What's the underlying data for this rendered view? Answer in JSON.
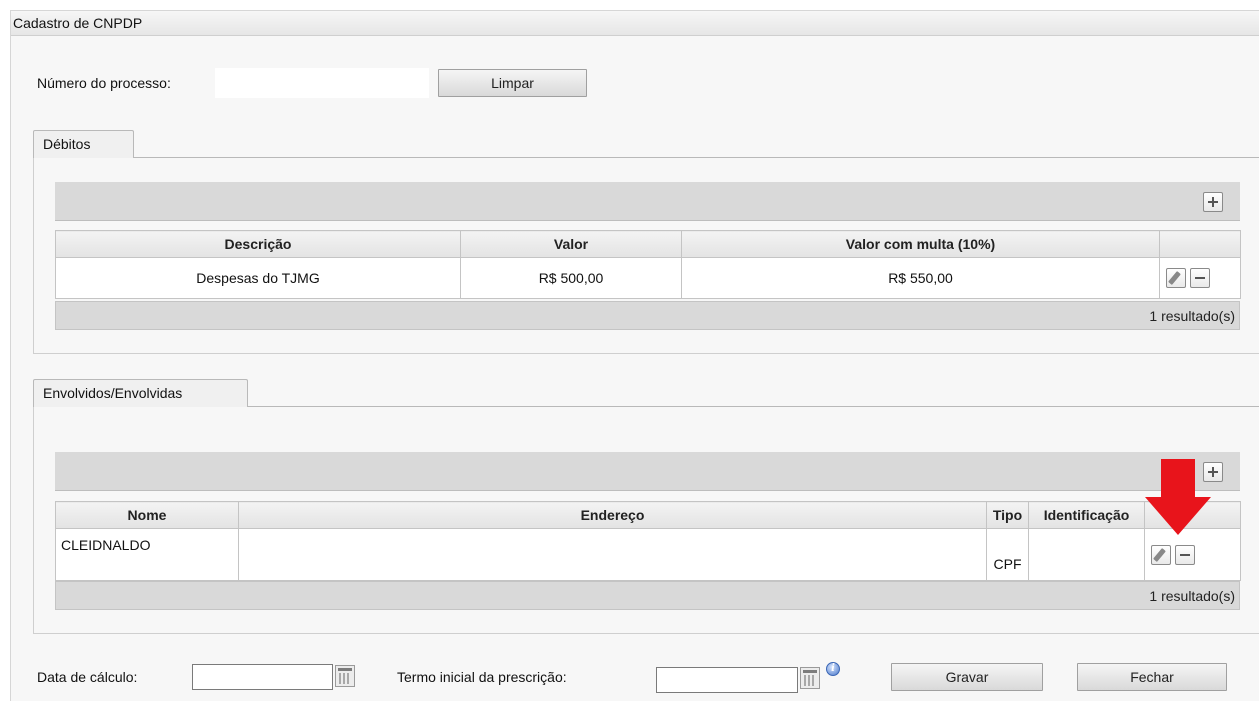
{
  "window": {
    "title": "Cadastro de CNPDP"
  },
  "process": {
    "label": "Número do processo:",
    "value": "",
    "clear_label": "Limpar"
  },
  "debitos": {
    "tab_label": "Débitos",
    "columns": [
      "Descrição",
      "Valor",
      "Valor com multa (10%)"
    ],
    "rows": [
      {
        "descricao": "Despesas do TJMG",
        "valor": "R$ 500,00",
        "valor_multa": "R$ 550,00"
      }
    ],
    "result_count": "1 resultado(s)"
  },
  "envolvidos": {
    "tab_label": "Envolvidos/Envolvidas",
    "columns": [
      "Nome",
      "Endereço",
      "Tipo",
      "Identificação"
    ],
    "rows": [
      {
        "nome": "CLEIDNALDO",
        "endereco": "",
        "tipo": "CPF",
        "identificacao": ""
      }
    ],
    "result_count": "1 resultado(s)"
  },
  "footer_form": {
    "data_calculo_label": "Data de cálculo:",
    "data_calculo_value": "",
    "termo_label": "Termo inicial da prescrição:",
    "termo_value": "",
    "save_label": "Gravar",
    "close_label": "Fechar"
  },
  "colors": {
    "annotation_arrow": "#e8141b",
    "toolbar": "#d9d9d9",
    "panel": "#f7f7f7"
  },
  "icons": [
    "plus-icon",
    "pencil-icon",
    "minus-icon",
    "calendar-icon",
    "info-icon",
    "arrow-down-icon"
  ]
}
